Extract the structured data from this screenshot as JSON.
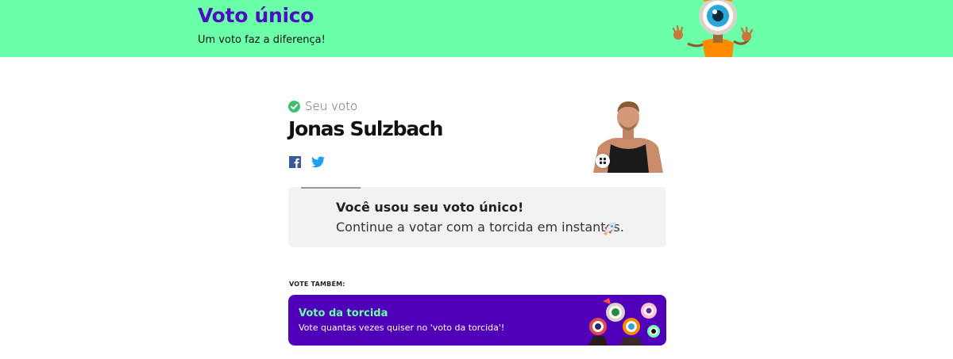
{
  "header": {
    "title": "Voto único",
    "subtitle": "Um voto faz a diferença!",
    "background": "#6cffa9",
    "title_color": "#4a10c0",
    "mascot_icon": "eye-mascot"
  },
  "vote": {
    "status_icon": "check-circle-icon",
    "status_color": "#3dbf6f",
    "label": "Seu voto",
    "candidate_name": "Jonas Sulzbach",
    "share": [
      {
        "name": "facebook",
        "icon": "facebook-icon",
        "color": "#3b5998"
      },
      {
        "name": "twitter",
        "icon": "twitter-icon",
        "color": "#1da1f2"
      }
    ]
  },
  "notice": {
    "title": "Você usou seu voto único!",
    "text": "Continue a votar com a torcida em instantes.",
    "emoji_icon": "rocket-icon"
  },
  "also_vote": {
    "label": "VOTE TAMBÉM:"
  },
  "cta": {
    "title": "Voto da torcida",
    "text": "Vote quantas vezes quiser no 'voto da torcida'!",
    "background": "#5000b9",
    "title_color": "#6cffa9"
  }
}
